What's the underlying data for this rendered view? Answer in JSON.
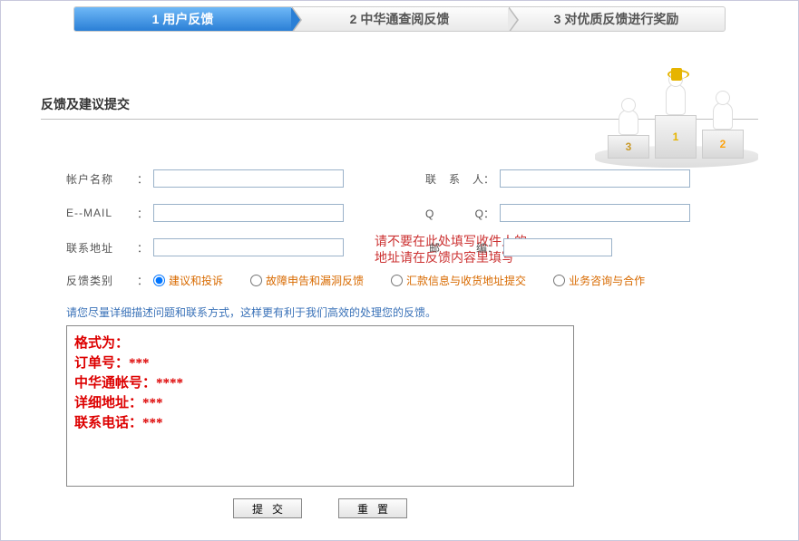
{
  "steps": {
    "s1": "1 用户反馈",
    "s2": "2 中华通查阅反馈",
    "s3": "3 对优质反馈进行奖励"
  },
  "section_title": "反馈及建议提交",
  "labels": {
    "account": "帐户名称",
    "email": "E--MAIL",
    "address": "联系地址",
    "category": "反馈类别",
    "contact": "联 系 人",
    "qq": "Q　　Q",
    "postcode": "邮编",
    "colon": "："
  },
  "address_note_line1": "请不要在此处填写收件人的",
  "address_note_line2": "地址请在反馈内容里填写",
  "categories": {
    "c1": "建议和投诉",
    "c2": "故障申告和漏洞反馈",
    "c3": "汇款信息与收货地址提交",
    "c4": "业务咨询与合作"
  },
  "hint": "请您尽量详细描述问题和联系方式，这样更有利于我们高效的处理您的反馈。",
  "textarea_default": "格式为：\n订单号：***\n中华通帐号：****\n详细地址：***\n联系电话：***",
  "buttons": {
    "submit": "提交",
    "reset": "重置"
  },
  "podium": {
    "n1": "1",
    "n2": "2",
    "n3": "3"
  }
}
